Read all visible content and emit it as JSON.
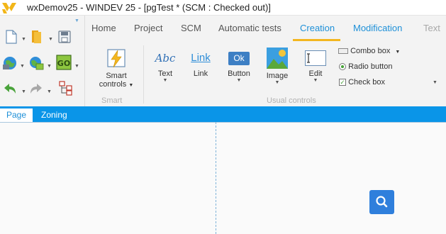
{
  "window": {
    "title": "wxDemov25 - WINDEV 25 - [pgTest * (SCM : Checked out)]"
  },
  "quick_access": [
    {
      "icon": "new-document-icon"
    },
    {
      "icon": "open-folder-icon"
    },
    {
      "icon": "save-icon"
    },
    {
      "icon": "project-globe-icon"
    },
    {
      "icon": "test-globe-icon"
    },
    {
      "icon": "go-icon",
      "label": "GO"
    },
    {
      "icon": "undo-icon"
    },
    {
      "icon": "redo-icon"
    },
    {
      "icon": "hierarchy-icon"
    }
  ],
  "tabs": [
    {
      "label": "Home"
    },
    {
      "label": "Project"
    },
    {
      "label": "SCM"
    },
    {
      "label": "Automatic tests"
    },
    {
      "label": "Creation"
    },
    {
      "label": "Modification"
    },
    {
      "label": "Text"
    }
  ],
  "active_tab": "Creation",
  "ribbon": {
    "smart": {
      "group_label": "Smart",
      "button": {
        "label_line1": "Smart",
        "label_line2": "controls",
        "icon": "lightning-icon"
      }
    },
    "usual": {
      "group_label": "Usual controls",
      "buttons": [
        {
          "label": "Text",
          "icon_text": "Abc"
        },
        {
          "label": "Link",
          "icon_text": "Link"
        },
        {
          "label": "Button",
          "icon_text": "Ok"
        },
        {
          "label": "Image",
          "icon": "image-icon"
        },
        {
          "label": "Edit",
          "icon": "edit-field-icon"
        }
      ],
      "small_controls": [
        {
          "label": "Combo box",
          "icon": "combo-box-icon"
        },
        {
          "label": "Radio button",
          "icon": "radio-button-icon"
        },
        {
          "label": "Check box",
          "icon": "check-box-icon"
        }
      ]
    }
  },
  "editor_tabs": [
    {
      "label": "Page"
    },
    {
      "label": "Zoning"
    }
  ],
  "canvas": {
    "fab_icon": "search-icon"
  },
  "colors": {
    "accent_blue": "#0a95e8",
    "active_tab_text": "#1e90d8",
    "active_tab_underline": "#f3b61f",
    "fab_blue": "#2f7fdc"
  }
}
